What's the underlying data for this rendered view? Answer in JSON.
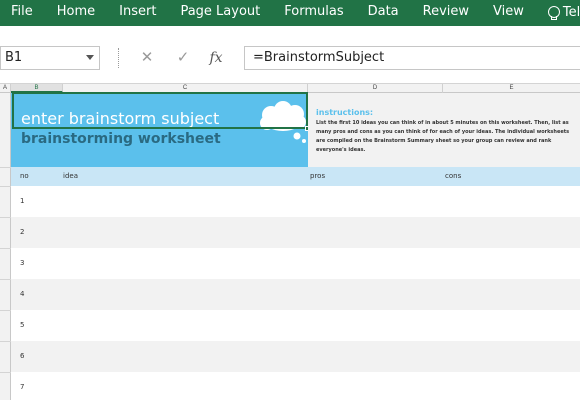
{
  "ribbon": {
    "tabs": [
      "File",
      "Home",
      "Insert",
      "Page Layout",
      "Formulas",
      "Data",
      "Review",
      "View"
    ],
    "tell_me": "Tell me"
  },
  "formula_bar": {
    "name_box": "B1",
    "cancel_icon": "✕",
    "enter_icon": "✓",
    "fx_label": "fx",
    "formula": "=BrainstormSubject"
  },
  "columns": [
    "A",
    "B",
    "C",
    "D",
    "E"
  ],
  "banner": {
    "title": "enter brainstorm subject",
    "subtitle": "brainstorming worksheet",
    "colors": {
      "banner_bg": "#5bc0ec",
      "subtitle": "#2a6a82",
      "selection": "#217346"
    },
    "icon": "thought-cloud-icon"
  },
  "instructions": {
    "heading": "instructions:",
    "body": "List the first 10 ideas you can think of in about 5 minutes on this worksheet. Then, list as many pros and cons as you can think of for each of your ideas. The individual worksheets are compiled on the Brainstorm Summary sheet so your group can review and rank everyone's ideas."
  },
  "table": {
    "headers": {
      "no": "no",
      "idea": "idea",
      "pros": "pros",
      "cons": "cons"
    },
    "row_numbers": [
      "1",
      "2",
      "3",
      "4",
      "5",
      "6",
      "7"
    ],
    "colors": {
      "header_bg": "#c9e6f6",
      "alt_row_bg": "#f2f2f2"
    }
  }
}
